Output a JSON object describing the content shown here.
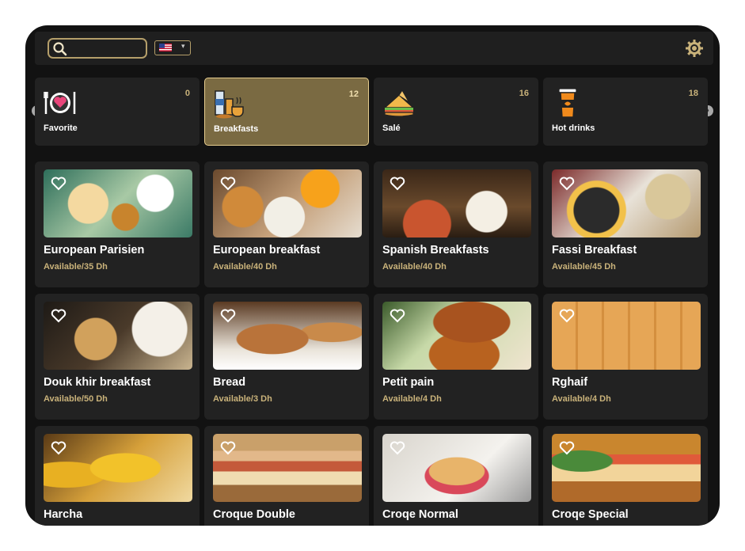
{
  "search": {
    "placeholder": "",
    "value": ""
  },
  "language": {
    "selected": "us-flag-icon"
  },
  "categories": [
    {
      "label": "Favorite",
      "count": "0",
      "icon": "heart-plate-icon"
    },
    {
      "label": "Breakfasts",
      "count": "12",
      "icon": "breakfast-icon"
    },
    {
      "label": "Salé",
      "count": "16",
      "icon": "sandwich-icon"
    },
    {
      "label": "Hot drinks",
      "count": "18",
      "icon": "coffee-cup-icon"
    }
  ],
  "items": [
    {
      "title": "European Parisien",
      "sub": "Available/35 Dh"
    },
    {
      "title": "European breakfast",
      "sub": "Available/40 Dh"
    },
    {
      "title": "Spanish Breakfasts",
      "sub": "Available/40 Dh"
    },
    {
      "title": "Fassi Breakfast",
      "sub": "Available/45 Dh"
    },
    {
      "title": "Douk khir breakfast",
      "sub": "Available/50 Dh"
    },
    {
      "title": "Bread",
      "sub": "Available/3 Dh"
    },
    {
      "title": "Petit pain",
      "sub": "Available/4 Dh"
    },
    {
      "title": "Rghaif",
      "sub": "Available/4 Dh"
    },
    {
      "title": "Harcha",
      "sub": ""
    },
    {
      "title": "Croque Double",
      "sub": ""
    },
    {
      "title": "Croqe Normal",
      "sub": ""
    },
    {
      "title": "Croqe Special",
      "sub": ""
    }
  ],
  "colors": {
    "accent": "#c9b27a",
    "active": "#7a6a42",
    "background": "#121212",
    "card": "#222222"
  }
}
